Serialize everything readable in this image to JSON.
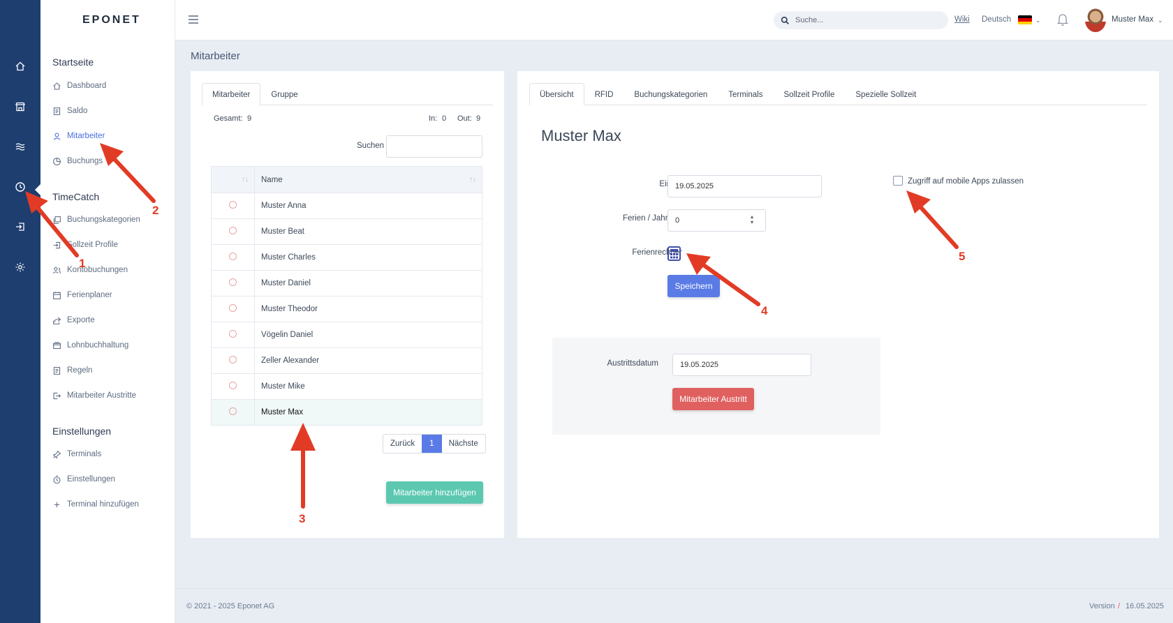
{
  "app": {
    "logo": "EPONET"
  },
  "iconbar": {
    "icons": [
      "home-icon",
      "store-icon",
      "waves-icon",
      "clock-icon",
      "login-icon",
      "gear-icon"
    ],
    "accent": "#1e3e70"
  },
  "sidebar": {
    "sections": [
      {
        "title": "Startseite",
        "items": [
          "Dashboard",
          "Saldo",
          "Mitarbeiter",
          "Buchungs"
        ]
      },
      {
        "title": "TimeCatch",
        "items": [
          "Buchungskategorien",
          "Sollzeit Profile",
          "Kontobuchungen",
          "Ferienplaner",
          "Exporte",
          "Lohnbuchhaltung",
          "Regeln",
          "Mitarbeiter Austritte"
        ]
      },
      {
        "title": "Einstellungen",
        "items": [
          "Terminals",
          "Einstellungen",
          "Terminal hinzufügen"
        ]
      }
    ],
    "active_item": "Mitarbeiter"
  },
  "header": {
    "search_placeholder": "Suche...",
    "wiki": "Wiki",
    "language": "Deutsch",
    "user_name": "Muster Max"
  },
  "page": {
    "title": "Mitarbeiter"
  },
  "left_card": {
    "tabs": [
      "Mitarbeiter",
      "Gruppe"
    ],
    "gesamt_label": "Gesamt:",
    "gesamt_value": "9",
    "in_label": "In:",
    "in_value": "0",
    "out_label": "Out:",
    "out_value": "9",
    "search_label": "Suchen",
    "search_value": "",
    "table_header": "Name",
    "rows": [
      "Muster Anna",
      "Muster Beat",
      "Muster Charles",
      "Muster Daniel",
      "Muster Theodor",
      "Vögelin Daniel",
      "Zeller Alexander",
      "Muster Mike",
      "Muster Max"
    ],
    "selected_row": "Muster Max",
    "pager": {
      "prev": "Zurück",
      "current": "1",
      "next": "Nächste"
    },
    "add_button": "Mitarbeiter hinzufügen"
  },
  "right_card": {
    "tabs": [
      "Übersicht",
      "RFID",
      "Buchungskategorien",
      "Terminals",
      "Sollzeit Profile",
      "Spezielle Sollzeit"
    ],
    "employee_name": "Muster Max",
    "eintritt_label": "Eintritt",
    "eintritt_value": "19.05.2025",
    "ferien_label": "Ferien / Jahr Std",
    "ferien_value": "0",
    "ferienrechner_label": "Ferienrechner",
    "save_button": "Speichern",
    "mobile_access_label": "Zugriff auf mobile Apps zulassen",
    "mobile_access_checked": false,
    "austritt_label": "Austrittsdatum",
    "austritt_value": "19.05.2025",
    "austritt_button": "Mitarbeiter Austritt"
  },
  "footer": {
    "copyright": "© 2021 - 2025 Eponet AG",
    "version_label": "Version",
    "version_sep": "/",
    "version_date": "16.05.2025"
  },
  "annotations": [
    "1",
    "2",
    "3",
    "4",
    "5"
  ],
  "colors": {
    "primary": "#5a7be6",
    "success": "#5cc8b0",
    "danger": "#e06060",
    "arrow": "#e23b25"
  }
}
